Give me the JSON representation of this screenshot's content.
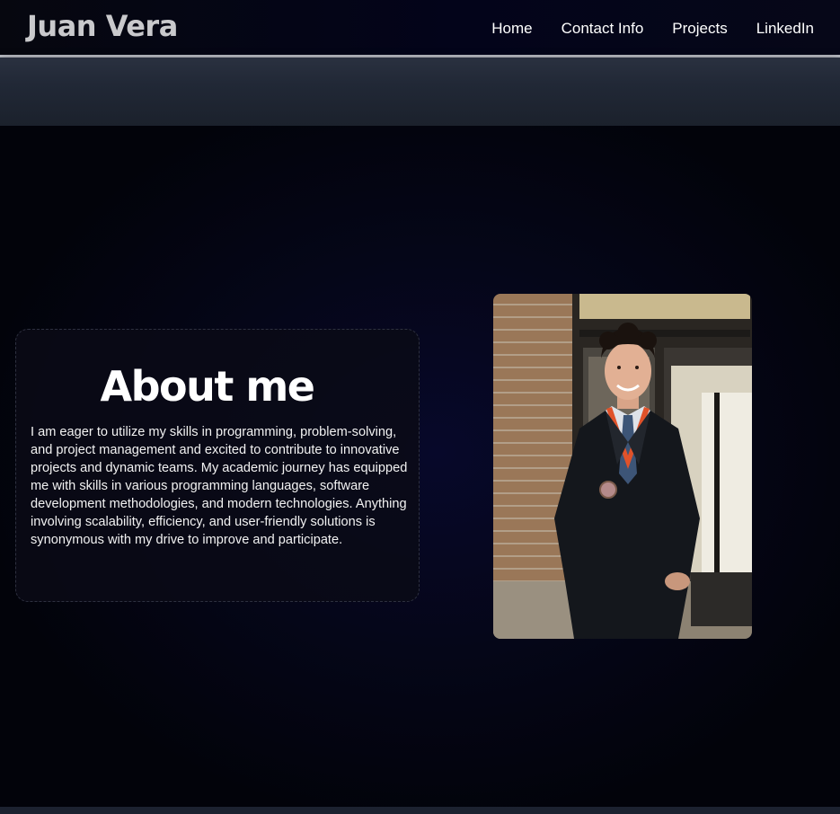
{
  "header": {
    "brand": "Juan Vera",
    "nav": [
      {
        "label": "Home"
      },
      {
        "label": "Contact Info"
      },
      {
        "label": "Projects"
      },
      {
        "label": "LinkedIn"
      }
    ]
  },
  "about": {
    "title": "About me",
    "body": "I am eager to utilize my skills in programming, problem-solving, and project management and excited to contribute to innovative projects and dynamic teams. My academic journey has equipped me with skills in various programming languages, software development methodologies, and modern technologies. Anything involving scalability, efficiency, and user-friendly solutions is synonymous with my drive to improve and participate."
  },
  "photo": {
    "icon": "portrait-photo"
  },
  "colors": {
    "background": "#02030a",
    "header_border": "#b9bcc4",
    "subbar": "#212836",
    "brand_text": "#c9c9cc",
    "text": "#ffffff"
  }
}
